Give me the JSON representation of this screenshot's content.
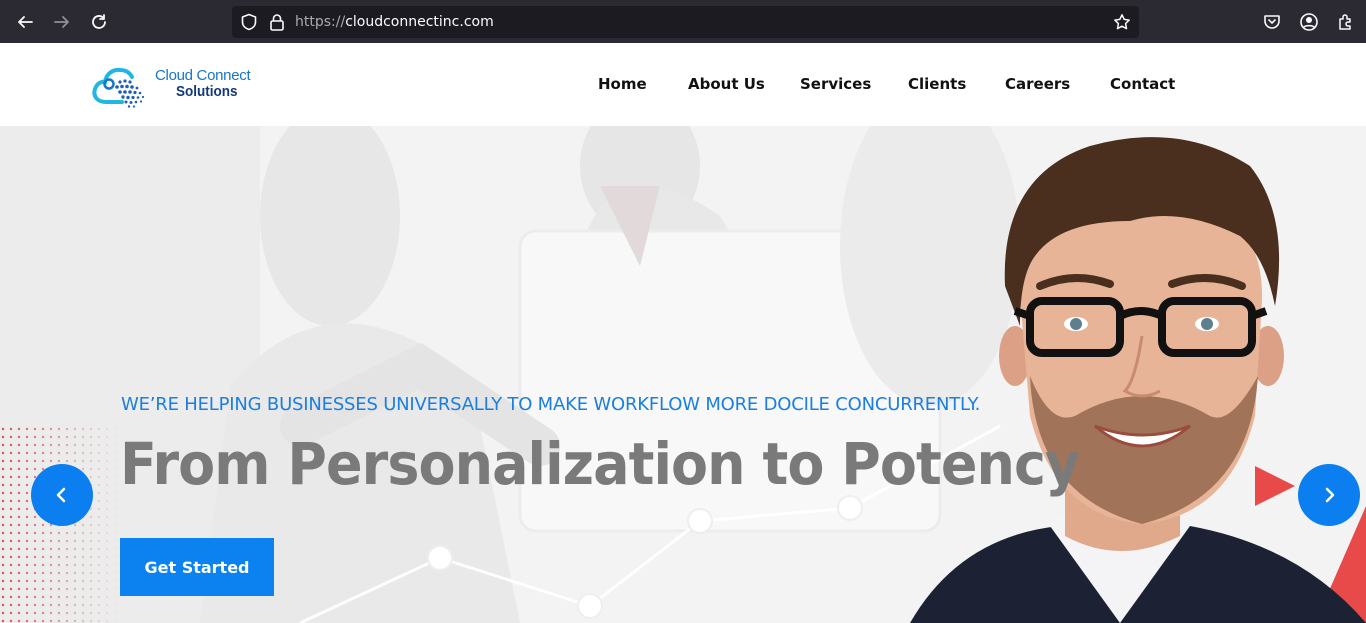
{
  "browser": {
    "url_protocol": "https://",
    "url_host": "cloudconnectinc.com",
    "icons": [
      "back-arrow-icon",
      "forward-arrow-icon",
      "reload-icon",
      "shield-icon",
      "lock-icon",
      "bookmark-star-icon",
      "pocket-icon",
      "account-icon",
      "extensions-icon"
    ]
  },
  "logo": {
    "line1": "Cloud Connect",
    "line2": "Solutions"
  },
  "nav": {
    "items": [
      {
        "label": "Home"
      },
      {
        "label": "About Us"
      },
      {
        "label": "Services"
      },
      {
        "label": "Clients"
      },
      {
        "label": "Careers"
      },
      {
        "label": "Contact"
      }
    ]
  },
  "hero": {
    "subtitle": "WE’RE HELPING BUSINESSES UNIVERSALLY TO MAKE WORKFLOW MORE DOCILE CONCURRENTLY.",
    "title": "From Personalization to Potency",
    "cta_label": "Get Started",
    "prev_icon": "chevron-left-icon",
    "next_icon": "chevron-right-icon"
  },
  "colors": {
    "accent": "#0b82f0",
    "browser_bg": "#2b2a33",
    "title_gray": "#7a7a7a",
    "subtitle_blue": "#1b7fe0",
    "decor_red": "#e84a4a"
  }
}
